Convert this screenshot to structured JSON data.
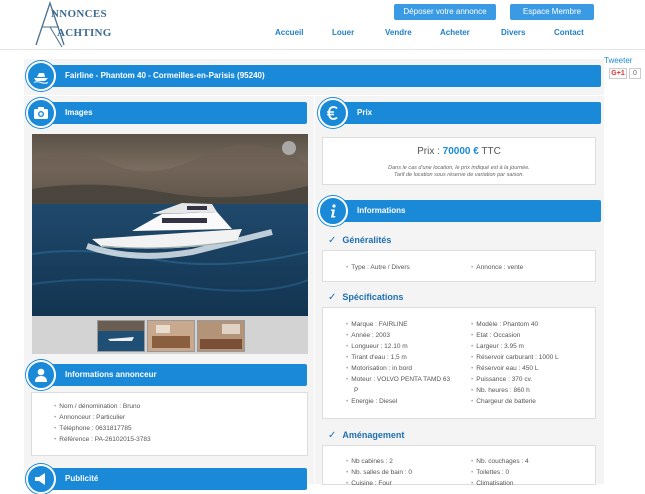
{
  "header": {
    "logo_line1": "NNONCES",
    "logo_line2": "ACHTING",
    "deposit_button": "Déposer votre annonce",
    "member_button": "Espace Membre",
    "nav": [
      "Accueil",
      "Louer",
      "Vendre",
      "Acheter",
      "Divers",
      "Contact"
    ]
  },
  "social": {
    "tweeter": "Tweeter",
    "gplus": "G+1",
    "gplus_count": "0"
  },
  "listing": {
    "title": "Fairline - Phantom 40 - Cormeilles-en-Parisis (95240)"
  },
  "images": {
    "title": "Images"
  },
  "advertiser": {
    "title": "Informations annonceur",
    "items": [
      "Nom / dénomination : Bruno",
      "Annonceur : Particulier",
      "Téléphone : 0631817785",
      "Référence : PA-26102015-3783"
    ]
  },
  "ad": {
    "title": "Publicité"
  },
  "price": {
    "title": "Prix",
    "label": "Prix : ",
    "value": "70000 €",
    "suffix": " TTC",
    "note1": "Dans le cas d'une location, le prix indiqué est à la journée.",
    "note2": "Tarif de location sous réserve de variation par saison."
  },
  "info": {
    "title": "Informations",
    "general_title": "Généralités",
    "general": [
      "Type : Autre / Divers",
      "Annonce : vente"
    ],
    "specs_title": "Spécifications",
    "specs_left": [
      "Marque : FAIRLINE",
      "Année : 2003",
      "Longueur : 12.10 m",
      "Tirant d'eau : 1,5 m",
      "Motorisation : in bord",
      "Moteur : VOLVO PENTA TAMD 63",
      "P",
      "Energie : Diesel"
    ],
    "specs_right": [
      "Modèle : Phantom 40",
      "Etat : Occasion",
      "Largeur : 3.95 m",
      "Réservoir carburant : 1000 L",
      "Réservoir eau : 450 L",
      "Puissance : 370 cv.",
      "Nb. heures : 860 h",
      "Chargeur de batterie"
    ],
    "layout_title": "Aménagement",
    "layout_left": [
      "Nb cabines : 2",
      "Nb. salles de bain : 0",
      "Cuisine : Four"
    ],
    "layout_right": [
      "Nb. couchages : 4",
      "Toilettes : 0",
      "Climatisation"
    ]
  }
}
